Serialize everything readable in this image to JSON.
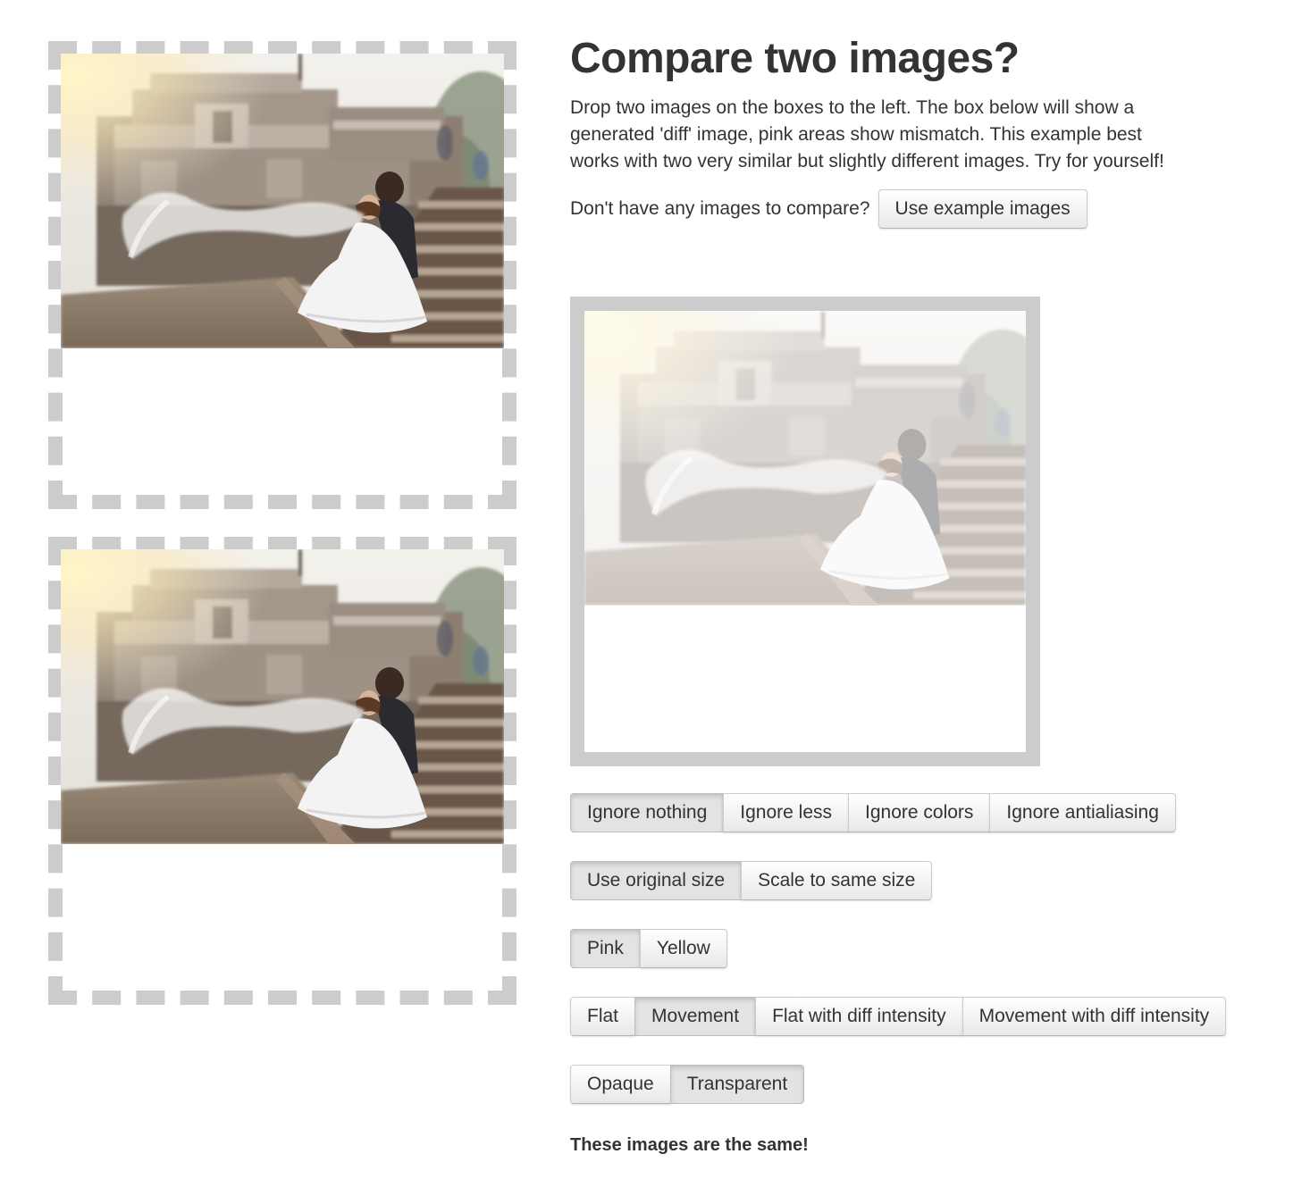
{
  "header": {
    "title": "Compare two images?",
    "description": "Drop two images on the boxes to the left. The box below will show a generated 'diff' image, pink areas show mismatch. This example best works with two very similar but slightly different images. Try for yourself!"
  },
  "example": {
    "question": "Don't have any images to compare?",
    "button_label": "Use example images"
  },
  "option_groups": [
    {
      "name": "ignore",
      "options": [
        "Ignore nothing",
        "Ignore less",
        "Ignore colors",
        "Ignore antialiasing"
      ],
      "selected": "Ignore nothing"
    },
    {
      "name": "scaling",
      "options": [
        "Use original size",
        "Scale to same size"
      ],
      "selected": "Use original size"
    },
    {
      "name": "error-color",
      "options": [
        "Pink",
        "Yellow"
      ],
      "selected": "Pink"
    },
    {
      "name": "error-type",
      "options": [
        "Flat",
        "Movement",
        "Flat with diff intensity",
        "Movement with diff intensity"
      ],
      "selected": "Movement"
    },
    {
      "name": "transparency",
      "options": [
        "Opaque",
        "Transparent"
      ],
      "selected": "Transparent"
    }
  ],
  "result": {
    "message": "These images are the same!"
  },
  "colors": {
    "dropzone_border": "#cccccc",
    "text": "#333333",
    "active_button": "#e3e3e3"
  }
}
